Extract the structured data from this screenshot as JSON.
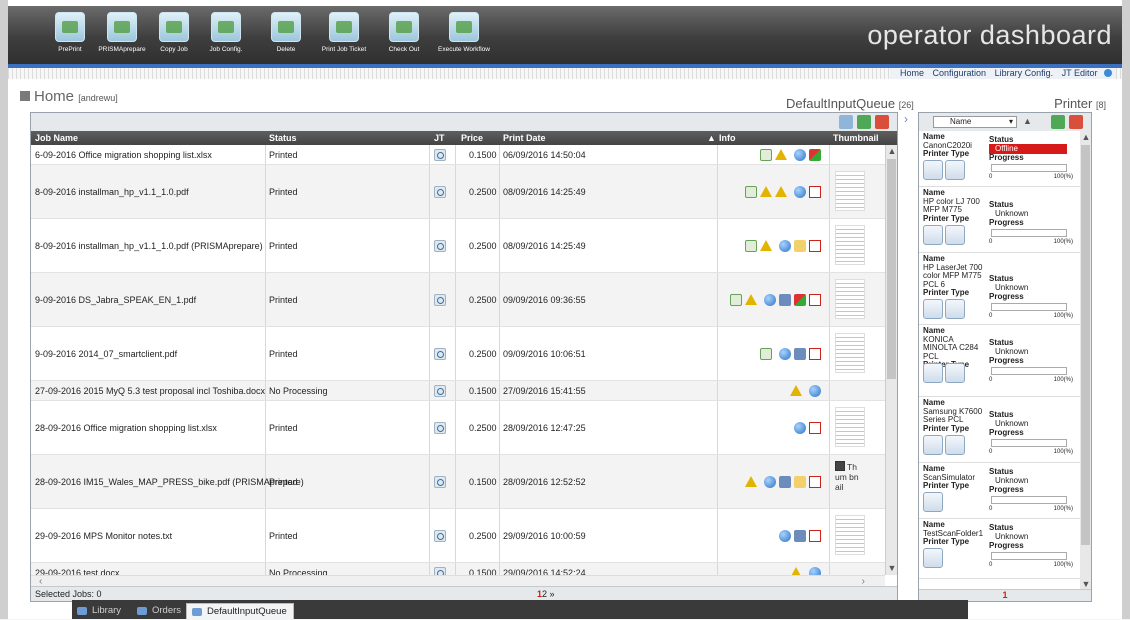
{
  "toolbar": {
    "buttons": [
      {
        "label": "PrePrint"
      },
      {
        "label": "PRISMAprepare"
      },
      {
        "label": "Copy Job"
      },
      {
        "label": "Job Config."
      },
      {
        "label": "Delete"
      },
      {
        "label": "Print Job Ticket"
      },
      {
        "label": "Check Out"
      },
      {
        "label": "Execute Workflow"
      }
    ],
    "brand": "operator dashboard"
  },
  "top_links": [
    "Home",
    "Configuration",
    "Library Config.",
    "JT Editor"
  ],
  "home": {
    "title": "Home",
    "user": "[andrewu]"
  },
  "queue": {
    "title": "DefaultInputQueue",
    "count": "[26]",
    "columns": [
      "Job Name",
      "Status",
      "JT",
      "Price",
      "Print Date",
      "Info",
      "Thumbnail"
    ],
    "rows": [
      {
        "name": "6-09-2016 Office migration shopping list.xlsx",
        "status": "Printed",
        "price": "0.1500",
        "date": "06/09/2016 14:50:04",
        "info": [
          "edit-icon",
          "warning-icon",
          "globe-icon",
          "flag-icon"
        ],
        "thumb": "none"
      },
      {
        "name": "8-09-2016 installman_hp_v1.1_1.0.pdf",
        "status": "Printed",
        "price": "0.2500",
        "date": "08/09/2016 14:25:49",
        "info": [
          "edit-icon",
          "warning-icon",
          "warning-icon",
          "globe-icon",
          "pdf-icon"
        ],
        "thumb": "page"
      },
      {
        "name": "8-09-2016 installman_hp_v1.1_1.0.pdf (PRISMAprepare)",
        "status": "Printed",
        "price": "0.2500",
        "date": "08/09/2016 14:25:49",
        "info": [
          "edit-icon",
          "warning-icon",
          "globe-icon",
          "note-icon",
          "pdf-icon"
        ],
        "thumb": "page"
      },
      {
        "name": "9-09-2016 DS_Jabra_SPEAK_EN_1.pdf",
        "status": "Printed",
        "price": "0.2500",
        "date": "09/09/2016 09:36:55",
        "info": [
          "edit-icon",
          "warning-icon",
          "globe-icon",
          "truck-icon",
          "flag-icon",
          "pdf-icon"
        ],
        "thumb": "page"
      },
      {
        "name": "9-09-2016 2014_07_smartclient.pdf",
        "status": "Printed",
        "price": "0.2500",
        "date": "09/09/2016 10:06:51",
        "info": [
          "edit-icon",
          "globe-icon",
          "truck-icon",
          "pdf-icon"
        ],
        "thumb": "page"
      },
      {
        "name": "27-09-2016 2015 MyQ 5.3 test proposal incl Toshiba.docx",
        "status": "No Processing",
        "price": "0.1500",
        "date": "27/09/2016 15:41:55",
        "info": [
          "warning-icon",
          "globe-icon"
        ],
        "thumb": "none"
      },
      {
        "name": "28-09-2016 Office migration shopping list.xlsx",
        "status": "Printed",
        "price": "0.2500",
        "date": "28/09/2016 12:47:25",
        "info": [
          "globe-icon",
          "pdf-icon"
        ],
        "thumb": "page"
      },
      {
        "name": "28-09-2016 IM15_Wales_MAP_PRESS_bike.pdf (PRISMAprepare)",
        "status": "Printed",
        "price": "0.1500",
        "date": "28/09/2016 12:52:52",
        "info": [
          "warning-icon",
          "globe-icon",
          "truck-icon",
          "note-icon",
          "pdf-icon"
        ],
        "thumb": "text",
        "thumb_text": "Th um bn ail"
      },
      {
        "name": "29-09-2016 MPS Monitor notes.txt",
        "status": "Printed",
        "price": "0.2500",
        "date": "29/09/2016 10:00:59",
        "info": [
          "globe-icon",
          "truck-icon",
          "pdf-icon"
        ],
        "thumb": "page"
      },
      {
        "name": "29-09-2016 test.docx",
        "status": "No Processing",
        "price": "0.1500",
        "date": "29/09/2016 14:52:24",
        "info": [
          "warning-icon",
          "globe-icon"
        ],
        "thumb": "none"
      }
    ],
    "footer": {
      "selected": "Selected Jobs: 0",
      "page_current": "1",
      "page_next": "2",
      "page_more": "»"
    }
  },
  "printers": {
    "title": "Printer",
    "count": "[8]",
    "sort_label": "Name",
    "labels": {
      "name": "Name",
      "status": "Status",
      "type": "Printer Type",
      "progress": "Progress",
      "min": "0",
      "max": "100(%)"
    },
    "items": [
      {
        "name": "CanonC2020i",
        "status": "Offline",
        "offline": true
      },
      {
        "name": "HP color LJ 700 MFP M775",
        "status": "Unknown"
      },
      {
        "name": "HP LaserJet 700 color MFP M775 PCL 6",
        "status": "Unknown"
      },
      {
        "name": "KONICA MINOLTA C284 PCL",
        "status": "Unknown"
      },
      {
        "name": "Samsung K7600 Series PCL",
        "status": "Unknown"
      },
      {
        "name": "ScanSimulator",
        "status": "Unknown"
      },
      {
        "name": "TestScanFolder1",
        "status": "Unknown"
      }
    ],
    "footer_page": "1"
  },
  "tabs": [
    {
      "label": "Library"
    },
    {
      "label": "Orders"
    },
    {
      "label": "DefaultInputQueue",
      "active": true
    }
  ]
}
